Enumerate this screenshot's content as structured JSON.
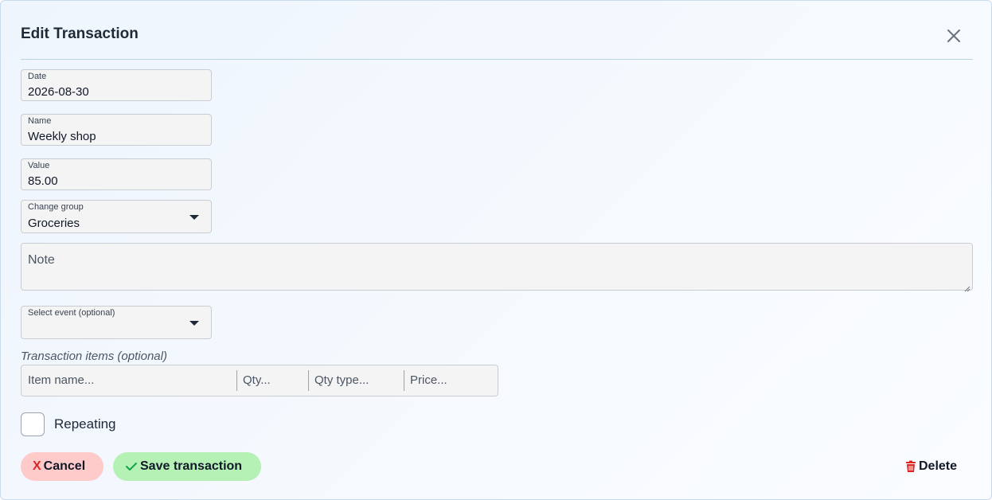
{
  "dialog": {
    "title": "Edit Transaction"
  },
  "form": {
    "date": {
      "label": "Date",
      "value": "2026-08-30"
    },
    "name": {
      "label": "Name",
      "value": "Weekly shop"
    },
    "value": {
      "label": "Value",
      "value": "85.00"
    },
    "change_group": {
      "label": "Change group",
      "value": "Groceries"
    },
    "note": {
      "placeholder": "Note"
    },
    "event": {
      "label": "Select event (optional)",
      "value": ""
    },
    "items": {
      "label": "Transaction items (optional)",
      "columns": [
        "Item name...",
        "Qty...",
        "Qty type...",
        "Price..."
      ]
    },
    "repeating": {
      "label": "Repeating",
      "checked": false
    }
  },
  "actions": {
    "cancel_label": "Cancel",
    "cancel_mark": "X",
    "save_label": "Save transaction",
    "delete_label": "Delete"
  },
  "colors": {
    "cancel_bg": "#fecaca",
    "save_bg": "#b5f0b5",
    "danger": "#dc2626",
    "success": "#16a34a"
  },
  "icons": {
    "close": "close-icon",
    "caret": "caret-down-icon",
    "check": "check-icon",
    "trash": "trash-icon"
  }
}
